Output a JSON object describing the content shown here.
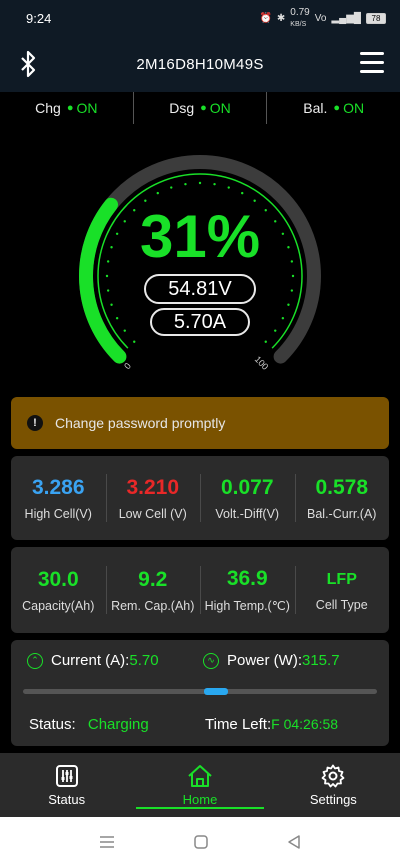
{
  "statusbar": {
    "time": "9:24",
    "net_speed": "0.79",
    "net_unit": "KB/S",
    "battery": "78"
  },
  "header": {
    "title": "2M16D8H10M49S"
  },
  "switches": [
    {
      "label": "Chg",
      "state": "ON"
    },
    {
      "label": "Dsg",
      "state": "ON"
    },
    {
      "label": "Bal.",
      "state": "ON"
    }
  ],
  "gauge": {
    "percent": "31%",
    "soc": 0.31,
    "voltage": "54.81V",
    "current": "5.70A",
    "min_label": "0",
    "max_label": "100"
  },
  "alert": {
    "text": "Change password promptly",
    "color": "#7a5200"
  },
  "cells": [
    {
      "value": "3.286",
      "label": "High Cell(V)",
      "color": "#3aa3f2"
    },
    {
      "value": "3.210",
      "label": "Low Cell (V)",
      "color": "#e82828"
    },
    {
      "value": "0.077",
      "label": "Volt.-Diff(V)",
      "color": "#19e028"
    },
    {
      "value": "0.578",
      "label": "Bal.-Curr.(A)",
      "color": "#19e028"
    }
  ],
  "capacity": [
    {
      "value": "30.0",
      "label": "Capacity(Ah)"
    },
    {
      "value": "9.2",
      "label": "Rem. Cap.(Ah)"
    },
    {
      "value": "36.9",
      "label": "High Temp.(℃)"
    },
    {
      "value": "LFP",
      "label": "Cell Type"
    }
  ],
  "power": {
    "current_label": "Current (A):",
    "current_value": "5.70",
    "power_label": "Power (W):",
    "power_value": "315.7",
    "status_label": "Status:",
    "status_value": "Charging",
    "time_left_label": "Time Left:",
    "time_left_value": "F 04:26:58",
    "progress_fraction": 0.55
  },
  "nav": [
    {
      "label": "Status",
      "icon": "sliders-icon"
    },
    {
      "label": "Home",
      "icon": "home-icon",
      "active": true
    },
    {
      "label": "Settings",
      "icon": "gear-icon"
    }
  ],
  "colors": {
    "accent": "#19e028",
    "header_bg": "#0f1a25",
    "card_bg": "#2b2b2b"
  }
}
